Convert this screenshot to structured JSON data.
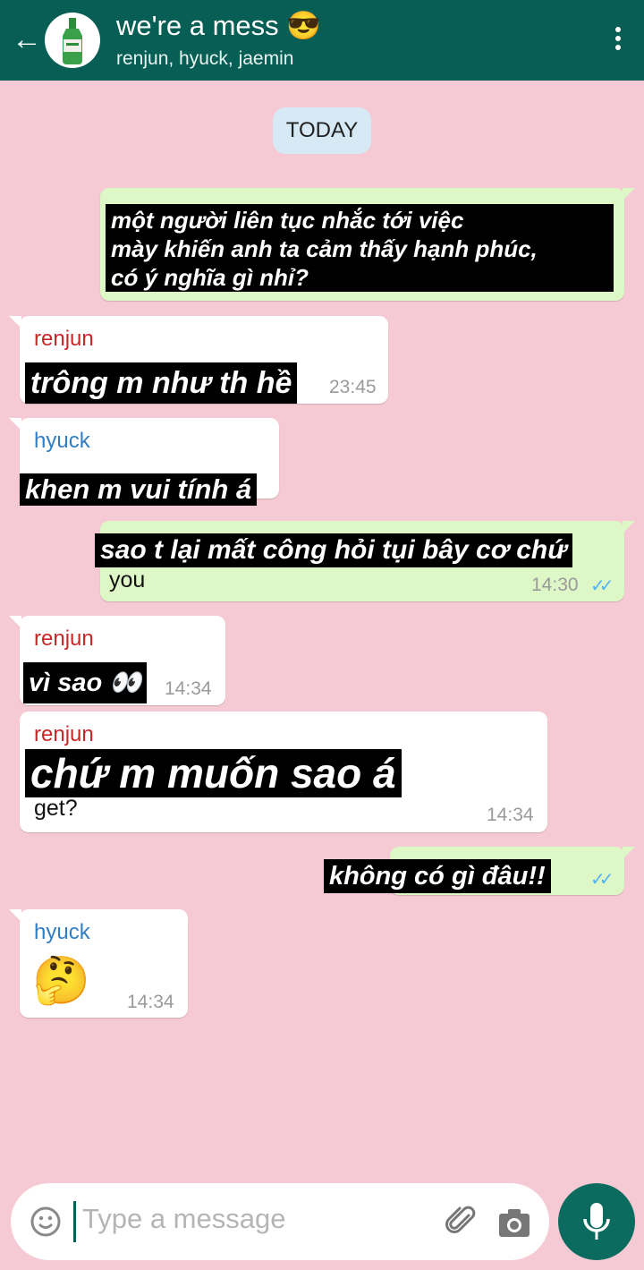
{
  "header": {
    "title": "we're a mess 😎",
    "subtitle": "renjun, hyuck, jaemin",
    "back_icon": "arrow-left-icon",
    "menu_icon": "more-vertical-icon"
  },
  "date_chip": "TODAY",
  "messages": [
    {
      "text": "một người liên tục nhắc tới việc\nmày khiến anh ta cảm thấy hạnh phúc,\ncó ý nghĩa gì nhỉ?"
    },
    {
      "sender": "renjun",
      "text": "trông m như th hề",
      "time": "23:45"
    },
    {
      "sender": "hyuck",
      "text": "khen m vui tính á"
    },
    {
      "text": "sao t lại mất công hỏi tụi bây cơ chứ",
      "extra": "you",
      "time": "14:30",
      "ticks": "✓✓"
    },
    {
      "sender": "renjun",
      "text": "vì sao 👀",
      "time": "14:34"
    },
    {
      "sender": "renjun",
      "text": "chứ m muốn sao á",
      "extra": "get?",
      "time": "14:34"
    },
    {
      "text": "không có gì đâu!!",
      "ticks": "✓✓"
    },
    {
      "sender": "hyuck",
      "text": "🤔",
      "time": "14:34"
    }
  ],
  "input": {
    "placeholder": "Type a message",
    "emoji_icon": "emoji-icon",
    "attach_icon": "paperclip-icon",
    "camera_icon": "camera-icon",
    "mic_icon": "mic-icon"
  },
  "colors": {
    "header": "#075e54",
    "background": "#f5cad4",
    "outgoing_bubble": "#ddf7c6",
    "incoming_bubble": "#ffffff",
    "sender_renjun": "#c62828",
    "sender_hyuck": "#2f7ec6",
    "read_ticks": "#4fb3f6"
  }
}
